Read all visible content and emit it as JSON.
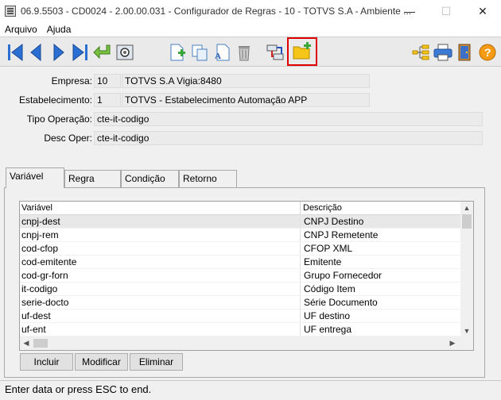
{
  "window": {
    "title": "06.9.5503 - CD0024 - 2.00.00.031 - Configurador de Regras - 10 - TOTVS S.A - Ambiente ...",
    "minimize": "—",
    "maximize": "☐",
    "close": "✕"
  },
  "menu": {
    "items": [
      "Arquivo",
      "Ajuda"
    ]
  },
  "toolbar": {
    "icons": [
      "first-record-icon",
      "previous-record-icon",
      "next-record-icon",
      "last-record-icon",
      "go-to-icon",
      "search-icon",
      "add-record-icon",
      "copy-icon",
      "edit-record-icon",
      "delete-icon",
      "related-items-icon",
      "new-folder-icon",
      "tree-icon",
      "print-icon",
      "exit-icon",
      "help-icon"
    ],
    "highlight_color": "#e00000"
  },
  "form": {
    "empresa_label": "Empresa:",
    "empresa_code": "10",
    "empresa_name": "TOTVS S.A Vigia:8480",
    "estab_label": "Estabelecimento:",
    "estab_code": "1",
    "estab_name": "TOTVS - Estabelecimento Automação APP",
    "tipo_label": "Tipo Operação:",
    "tipo_value": "cte-it-codigo",
    "desc_label": "Desc Oper:",
    "desc_value": "cte-it-codigo"
  },
  "tabs": [
    {
      "label": "Variável",
      "active": true
    },
    {
      "label": "Regra",
      "active": false
    },
    {
      "label": "Condição",
      "active": false
    },
    {
      "label": "Retorno",
      "active": false
    }
  ],
  "grid": {
    "headers": [
      "Variável",
      "Descrição"
    ],
    "rows": [
      [
        "cnpj-dest",
        "CNPJ Destino"
      ],
      [
        "cnpj-rem",
        "CNPJ Remetente"
      ],
      [
        "cod-cfop",
        "CFOP XML"
      ],
      [
        "cod-emitente",
        "Emitente"
      ],
      [
        "cod-gr-forn",
        "Grupo Fornecedor"
      ],
      [
        "it-codigo",
        "Código Item"
      ],
      [
        "serie-docto",
        "Série Documento"
      ],
      [
        "uf-dest",
        "UF destino"
      ],
      [
        "uf-ent",
        "UF entrega"
      ]
    ]
  },
  "buttons": {
    "incluir": "Incluir",
    "modificar": "Modificar",
    "eliminar": "Eliminar"
  },
  "status": {
    "text": "Enter data or press ESC to end."
  }
}
